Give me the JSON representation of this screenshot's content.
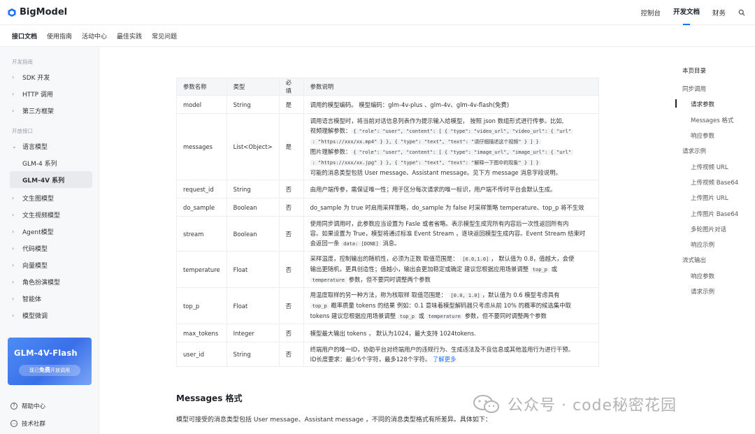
{
  "app": {
    "logo_text": "BigModel"
  },
  "topnav": {
    "items": [
      "控制台",
      "开发文档",
      "财务"
    ],
    "active": "开发文档"
  },
  "subnav": {
    "items": [
      "接口文档",
      "使用指南",
      "活动中心",
      "最佳实践",
      "常见问题"
    ],
    "active": "接口文档"
  },
  "sidebar": {
    "sections": [
      {
        "title": "开发指南",
        "items": [
          "SDK 开发",
          "HTTP 调用",
          "第三方框架"
        ]
      },
      {
        "title": "开放接口",
        "items": [
          "语言模型"
        ]
      }
    ],
    "language_model_children": [
      "GLM-4 系列",
      "GLM-4V 系列"
    ],
    "more_items": [
      "文生图模型",
      "文生视频模型",
      "Agent模型",
      "代码模型",
      "向量模型",
      "角色扮演模型",
      "智能体",
      "模型微调"
    ],
    "banner": {
      "title": "GLM-4V-Flash",
      "subtitle_a": "现已",
      "subtitle_b": "免费",
      "subtitle_c": "开放调用"
    },
    "footer": [
      "帮助中心",
      "技术社群"
    ]
  },
  "table": {
    "headers": [
      "参数名称",
      "类型",
      "必填",
      "参数说明"
    ],
    "rows": [
      {
        "name": "model",
        "type": "String",
        "required": "是",
        "desc": "调用的模型编码。 模型编码：glm-4v-plus 、glm-4v、glm-4v-flash(免费)"
      },
      {
        "name": "messages",
        "type": "List<Object>",
        "required": "是",
        "desc_1": "调用语言模型时，将当前对话信息列表作为提示输入给模型， 按照 json 数组形式进行传参。比如,",
        "desc_2": "视频理解参数：",
        "code_2": "{ \"role\": \"user\", \"content\": [ { \"type\": \"video_url\", \"video_url\": { \"url\"",
        "code_3": ": \"https://xxx/xx.mp4\" } }, { \"type\": \"text\", \"text\": \"请仔细描述这个视频\" } ] }",
        "desc_4": "图片理解参数：",
        "code_4": "{ \"role\": \"user\", \"content\": [ { \"type\": \"image_url\", \"image_url\": { \"url\"",
        "code_5": ": \"https://xxx/xx.jpg\" } }, { \"type\": \"text\", \"text\": \"解释一下图中的现象\" } ] }",
        "desc_6": "可能的消息类型包括 User message、Assistant message。见下方 message 消息字段说明。"
      },
      {
        "name": "request_id",
        "type": "String",
        "required": "否",
        "desc": "由用户端传参，需保证唯一性；用于区分每次请求的唯一标识，用户端不传时平台会默认生成。"
      },
      {
        "name": "do_sample",
        "type": "Boolean",
        "required": "否",
        "desc": "do_sample 为 true 时启用采样策略，do_sample 为 false 时采样策略 temperature、top_p 将不生效"
      },
      {
        "name": "stream",
        "type": "Boolean",
        "required": "否",
        "desc_1": "使用同步调用时，此参数应当设置为 Fasle 或者省略。表示模型生成完所有内容后一次性返回所有内",
        "desc_2": "容。如果设置为 True，模型将通过标准 Event Stream ，逐块返回模型生成内容。Event Stream 结束时",
        "desc_3a": "会返回一条",
        "code_3": "data: [DONE]",
        "desc_3b": "消息。"
      },
      {
        "name": "temperature",
        "type": "Float",
        "required": "否",
        "desc_1a": "采样温度，控制输出的随机性，必须为正数 取值范围是：",
        "code_1": "[0.0,1.0]",
        "desc_1b": "， 默认值为 0.8，值越大，会使",
        "desc_2a": "输出更随机，更具创造性；值越小，输出会更加稳定或确定 建议您根据应用场景调整",
        "code_2": "top_p",
        "desc_2b": "或",
        "code_3": "temperature",
        "desc_3": "参数，但不要同时调整两个参数"
      },
      {
        "name": "top_p",
        "type": "Float",
        "required": "否",
        "desc_1a": "用温度取样的另一种方法，称为核取样 取值范围是：",
        "code_1": "[0.0, 1.0]",
        "desc_1b": "，默认值为 0.6 模型考虑具有",
        "code_2": "top_p",
        "desc_2": "概率质量 tokens 的结果 例如：0.1 意味着模型解码器只考虑从前 10% 的概率的候选集中取",
        "desc_3a": "tokens 建议您根据应用场景调整",
        "code_3a": "top_p",
        "desc_3b": "或",
        "code_3b": "temperature",
        "desc_3c": "参数，但不要同时调整两个参数"
      },
      {
        "name": "max_tokens",
        "type": "Integer",
        "required": "否",
        "desc": "模型最大输出 tokens ， 默认为1024，最大支持 1024tokens."
      },
      {
        "name": "user_id",
        "type": "String",
        "required": "否",
        "desc_1": "终端用户的唯一ID，协助平台对终端用户的违规行为、生成违法及不良信息或其他滥用行为进行干预。",
        "desc_2": "ID长度要求：最少6个字符，最多128个字符。",
        "link": "了解更多"
      }
    ]
  },
  "section": {
    "title": "Messages 格式",
    "desc": "模型可接受的消息类型包括 User message、Assistant message ，不同的消息类型格式有所差异。具体如下："
  },
  "toc": {
    "title": "本页目录",
    "items": [
      "同步调用",
      "请求参数",
      "Messages 格式",
      "响应参数",
      "请求示例",
      "上传视频 URL",
      "上传视频 Base64",
      "上传图片 URL",
      "上传图片 Base64",
      "多轮图片对话",
      "响应示例",
      "流式输出",
      "响应参数",
      "请求示例"
    ],
    "active": "请求参数"
  },
  "watermark": {
    "text": "公众号 · code秘密花园"
  },
  "colors": {
    "accent": "#1f6fff",
    "sidebar_bg": "#f7f8fa",
    "banner": "#3a6fe8"
  }
}
